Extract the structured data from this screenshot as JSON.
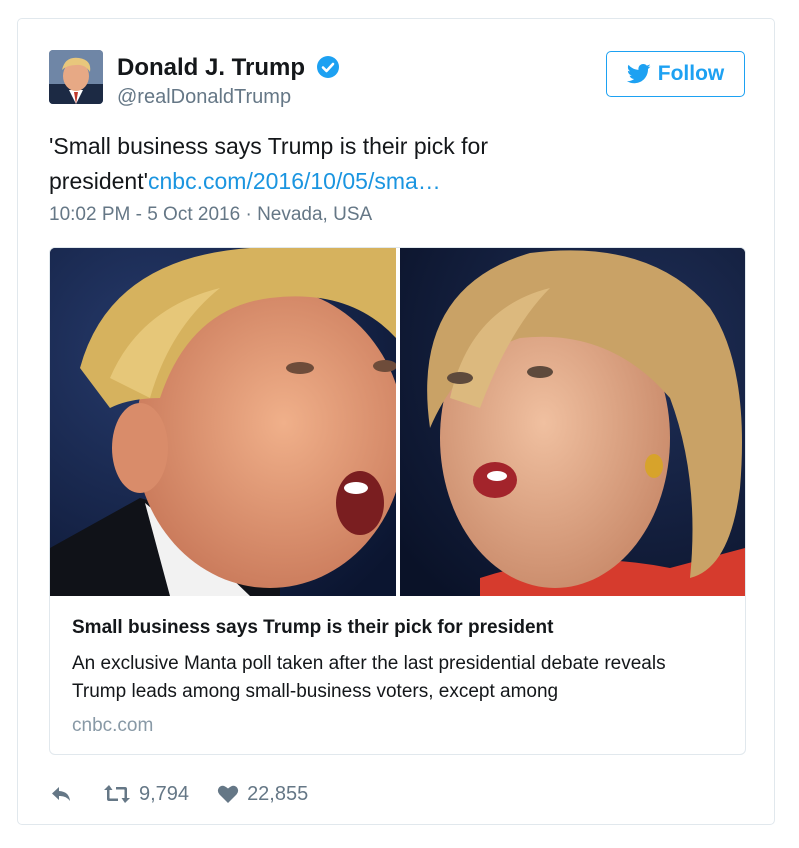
{
  "author": {
    "name": "Donald J. Trump",
    "handle": "@realDonaldTrump",
    "verified_icon": "verified-badge-icon"
  },
  "follow_button": {
    "label": "Follow",
    "icon": "twitter-bird-icon"
  },
  "tweet": {
    "text": "'Small business says Trump is their pick for president'",
    "link_text": "cnbc.com/2016/10/05/sma…",
    "timestamp": "10:02 PM - 5 Oct 2016",
    "location_separator": " · ",
    "location": "Nevada, USA"
  },
  "card": {
    "title": "Small business says Trump is their pick for president",
    "description": "An exclusive Manta poll taken after the last presidential debate reveals Trump leads among small-business voters, except among",
    "domain": "cnbc.com"
  },
  "actions": {
    "reply_icon": "reply-icon",
    "retweet_icon": "retweet-icon",
    "retweet_count": "9,794",
    "like_icon": "heart-icon",
    "like_count": "22,855"
  },
  "colors": {
    "brand_blue": "#1da1f2",
    "link_blue": "#1b95e0",
    "secondary_text": "#657786",
    "border": "#e1e8ed"
  }
}
